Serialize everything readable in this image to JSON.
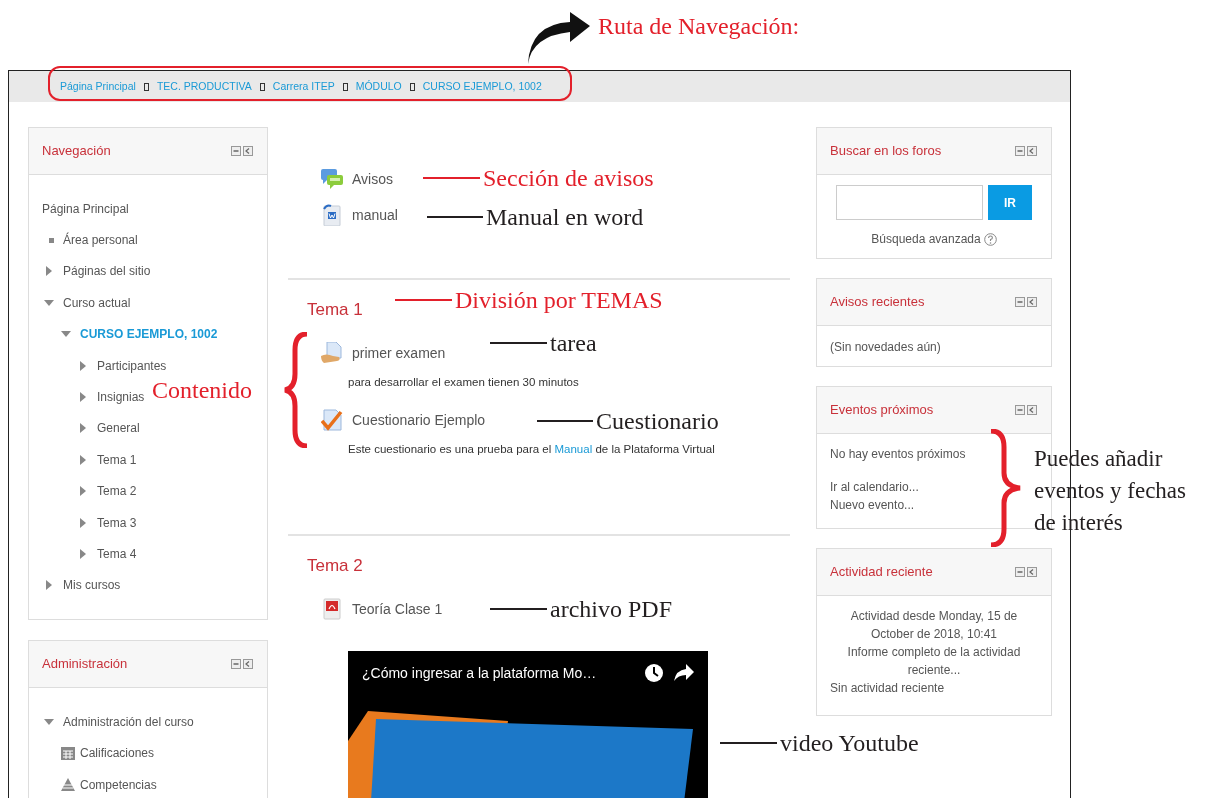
{
  "breadcrumb": [
    {
      "label": "Página Principal"
    },
    {
      "label": "TEC. PRODUCTIVA"
    },
    {
      "label": "Carrera ITEP"
    },
    {
      "label": "MÓDULO"
    },
    {
      "label": "CURSO EJEMPLO, 1002"
    }
  ],
  "navigation": {
    "title": "Navegación",
    "items": [
      {
        "label": "Página Principal",
        "kind": "plain",
        "selected": false
      },
      {
        "label": "Área personal",
        "kind": "bullet",
        "selected": false
      },
      {
        "label": "Páginas del sitio",
        "kind": "branch",
        "expanded": false,
        "selected": false
      },
      {
        "label": "Curso actual",
        "kind": "branch",
        "expanded": true,
        "selected": false,
        "children": [
          {
            "label": "CURSO EJEMPLO, 1002",
            "kind": "branch",
            "expanded": true,
            "selected": true,
            "children": [
              {
                "label": "Participantes",
                "kind": "branch",
                "expanded": false,
                "selected": false
              },
              {
                "label": "Insignias",
                "kind": "branch",
                "expanded": false,
                "selected": false
              },
              {
                "label": "General",
                "kind": "branch",
                "expanded": false,
                "selected": false
              },
              {
                "label": "Tema 1",
                "kind": "branch",
                "expanded": false,
                "selected": false
              },
              {
                "label": "Tema 2",
                "kind": "branch",
                "expanded": false,
                "selected": false
              },
              {
                "label": "Tema 3",
                "kind": "branch",
                "expanded": false,
                "selected": false
              },
              {
                "label": "Tema 4",
                "kind": "branch",
                "expanded": false,
                "selected": false
              }
            ]
          }
        ]
      },
      {
        "label": "Mis cursos",
        "kind": "branch",
        "expanded": false,
        "selected": false
      }
    ]
  },
  "administration": {
    "title": "Administración",
    "items": [
      {
        "label": "Administración del curso",
        "kind": "branch",
        "expanded": true,
        "selected": false,
        "children": [
          {
            "label": "Calificaciones",
            "kind": "grades",
            "selected": false
          },
          {
            "label": "Competencias",
            "kind": "competencies",
            "selected": false
          }
        ]
      }
    ]
  },
  "sections": [
    {
      "activities": [
        {
          "kind": "forum",
          "name": "Avisos"
        },
        {
          "kind": "word",
          "name": "manual"
        }
      ]
    },
    {
      "title": "Tema 1",
      "activities": [
        {
          "kind": "assignment",
          "name": "primer examen",
          "description": [
            {
              "text": "para desarrollar el examen tienen 30 minutos",
              "link": false
            }
          ]
        },
        {
          "kind": "quiz",
          "name": "Cuestionario Ejemplo",
          "description": [
            {
              "text": "Este cuestionario es una prueba para el ",
              "link": false
            },
            {
              "text": "Manual",
              "link": true
            },
            {
              "text": " de la Plataforma Virtual",
              "link": false
            }
          ]
        }
      ]
    },
    {
      "title": "Tema 2",
      "activities": [
        {
          "kind": "pdf",
          "name": "Teoría Clase 1"
        },
        {
          "kind": "video",
          "title": "¿Cómo ingresar a la plataforma Mo…"
        }
      ]
    }
  ],
  "blocks": [
    {
      "kind": "search",
      "title": "Buscar en los foros",
      "button": "IR",
      "link": "Búsqueda avanzada"
    },
    {
      "kind": "text",
      "title": "Avisos recientes",
      "message": "(Sin novedades aún)"
    },
    {
      "kind": "events",
      "title": "Eventos próximos",
      "message": "No hay eventos próximos",
      "links": [
        "Ir al calendario...",
        "Nuevo evento..."
      ]
    },
    {
      "kind": "activity",
      "title": "Actividad reciente",
      "since": "Actividad desde Monday, 15 de October de 2018, 10:41",
      "report_link": "Informe completo de la actividad reciente...",
      "message": "Sin actividad reciente"
    }
  ],
  "annotations": [
    {
      "kind": "arrow",
      "text": "Ruta de Navegación:",
      "color": "#e3202b"
    },
    {
      "kind": "leader",
      "text": "Sección de avisos",
      "color": "#e3202b"
    },
    {
      "kind": "leader",
      "text": "Manual en word",
      "color": "#231f20"
    },
    {
      "kind": "leader",
      "text": "División por TEMAS",
      "color": "#e3202b"
    },
    {
      "kind": "brace_left",
      "text": "Contenido",
      "color": "#e3202b"
    },
    {
      "kind": "leader",
      "text": "tarea",
      "color": "#231f20"
    },
    {
      "kind": "leader",
      "text": "Cuestionario",
      "color": "#231f20"
    },
    {
      "kind": "leader",
      "text": "archivo PDF",
      "color": "#231f20"
    },
    {
      "kind": "leader",
      "text": "video Youtube",
      "color": "#231f20"
    },
    {
      "kind": "brace_right",
      "text": "Puedes añadir eventos y fechas de interés",
      "color": "#231f20"
    }
  ]
}
